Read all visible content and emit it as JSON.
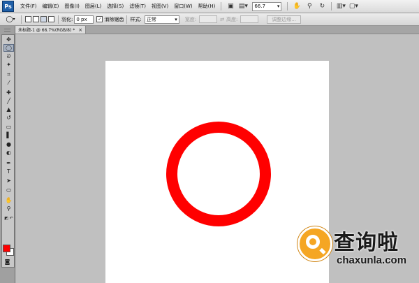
{
  "app": {
    "logo_text": "Ps"
  },
  "menu": [
    {
      "label": "文件(F)"
    },
    {
      "label": "编辑(E)"
    },
    {
      "label": "图像(I)"
    },
    {
      "label": "图层(L)"
    },
    {
      "label": "选择(S)"
    },
    {
      "label": "滤镜(T)"
    },
    {
      "label": "视图(V)"
    },
    {
      "label": "窗口(W)"
    },
    {
      "label": "帮助(H)"
    }
  ],
  "toolbar": {
    "zoom_value": "66.7",
    "icons": [
      "bridge-icon",
      "layout-icon",
      "hand-icon",
      "zoom-icon",
      "rotate-icon",
      "arrange-icon",
      "screen-mode-icon"
    ]
  },
  "options": {
    "feather_label": "羽化:",
    "feather_value": "0 px",
    "antialias_label": "消除锯齿",
    "antialias_checked": true,
    "style_label": "样式:",
    "style_value": "正常",
    "width_label": "宽度:",
    "height_label": "高度:",
    "refine_edge_label": "调整边缘..."
  },
  "document": {
    "tab_title": "未标题-1 @ 66.7%(RGB/8) *",
    "close_glyph": "×"
  },
  "colors": {
    "foreground": "#ff0000",
    "background": "#ffffff",
    "ring": "#ff0000"
  },
  "tools": [
    {
      "name": "move-tool-icon",
      "glyph": "✥"
    },
    {
      "name": "elliptical-marquee-tool-icon",
      "glyph": "◯",
      "active": true
    },
    {
      "name": "lasso-tool-icon",
      "glyph": "ᘐ"
    },
    {
      "name": "magic-wand-tool-icon",
      "glyph": "✦"
    },
    {
      "name": "crop-tool-icon",
      "glyph": "⌗"
    },
    {
      "name": "eyedropper-tool-icon",
      "glyph": "⁄"
    },
    {
      "name": "healing-brush-tool-icon",
      "glyph": "✚"
    },
    {
      "name": "brush-tool-icon",
      "glyph": "╱"
    },
    {
      "name": "clone-stamp-tool-icon",
      "glyph": "▲"
    },
    {
      "name": "history-brush-tool-icon",
      "glyph": "↺"
    },
    {
      "name": "eraser-tool-icon",
      "glyph": "▭"
    },
    {
      "name": "gradient-tool-icon",
      "glyph": "▌"
    },
    {
      "name": "blur-tool-icon",
      "glyph": "●"
    },
    {
      "name": "dodge-tool-icon",
      "glyph": "◐"
    },
    {
      "name": "pen-tool-icon",
      "glyph": "✒"
    },
    {
      "name": "type-tool-icon",
      "glyph": "T"
    },
    {
      "name": "path-selection-tool-icon",
      "glyph": "➤"
    },
    {
      "name": "shape-tool-icon",
      "glyph": "⬭"
    },
    {
      "name": "hand-tool-icon",
      "glyph": "✋"
    },
    {
      "name": "zoom-tool-icon",
      "glyph": "⚲"
    }
  ],
  "watermark": {
    "title": "查询啦",
    "domain": "chaxunla.com"
  }
}
